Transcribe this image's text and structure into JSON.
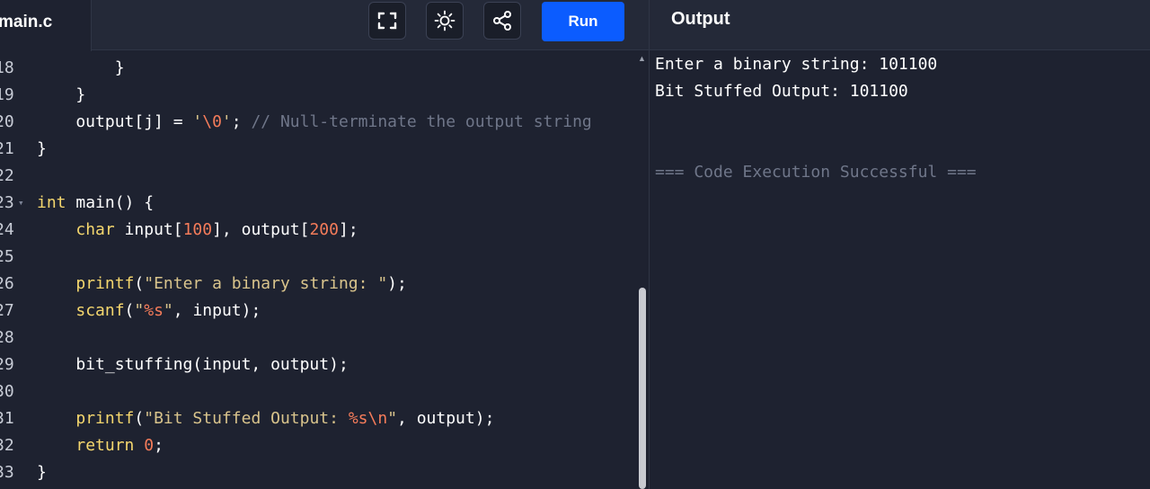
{
  "header": {
    "file_name": "main.c",
    "run_label": "Run",
    "output_title": "Output",
    "icons": [
      "fullscreen-icon",
      "theme-toggle-icon",
      "share-icon"
    ]
  },
  "editor": {
    "lines": [
      {
        "n": "18",
        "text": "        }"
      },
      {
        "n": "19",
        "text": "    }"
      },
      {
        "n": "20",
        "text": "    output[j] = '\\0'; // Null-terminate the output string"
      },
      {
        "n": "21",
        "text": "}"
      },
      {
        "n": "22",
        "text": ""
      },
      {
        "n": "23",
        "text": "int main() {"
      },
      {
        "n": "24",
        "text": "    char input[100], output[200];"
      },
      {
        "n": "25",
        "text": ""
      },
      {
        "n": "26",
        "text": "    printf(\"Enter a binary string: \");"
      },
      {
        "n": "27",
        "text": "    scanf(\"%s\", input);"
      },
      {
        "n": "28",
        "text": ""
      },
      {
        "n": "29",
        "text": "    bit_stuffing(input, output);"
      },
      {
        "n": "30",
        "text": ""
      },
      {
        "n": "31",
        "text": "    printf(\"Bit Stuffed Output: %s\\n\", output);"
      },
      {
        "n": "32",
        "text": "    return 0;"
      },
      {
        "n": "33",
        "text": "}"
      }
    ]
  },
  "output": {
    "lines": [
      "Enter a binary string: 101100",
      "Bit Stuffed Output: 101100",
      "",
      "",
      "=== Code Execution Successful ==="
    ]
  },
  "colors": {
    "run_button": "#0b5cff",
    "background": "#1e2230",
    "keyword": "#f5d76e",
    "string": "#d9c48c",
    "number": "#f57c5a",
    "comment": "#6f7689"
  }
}
